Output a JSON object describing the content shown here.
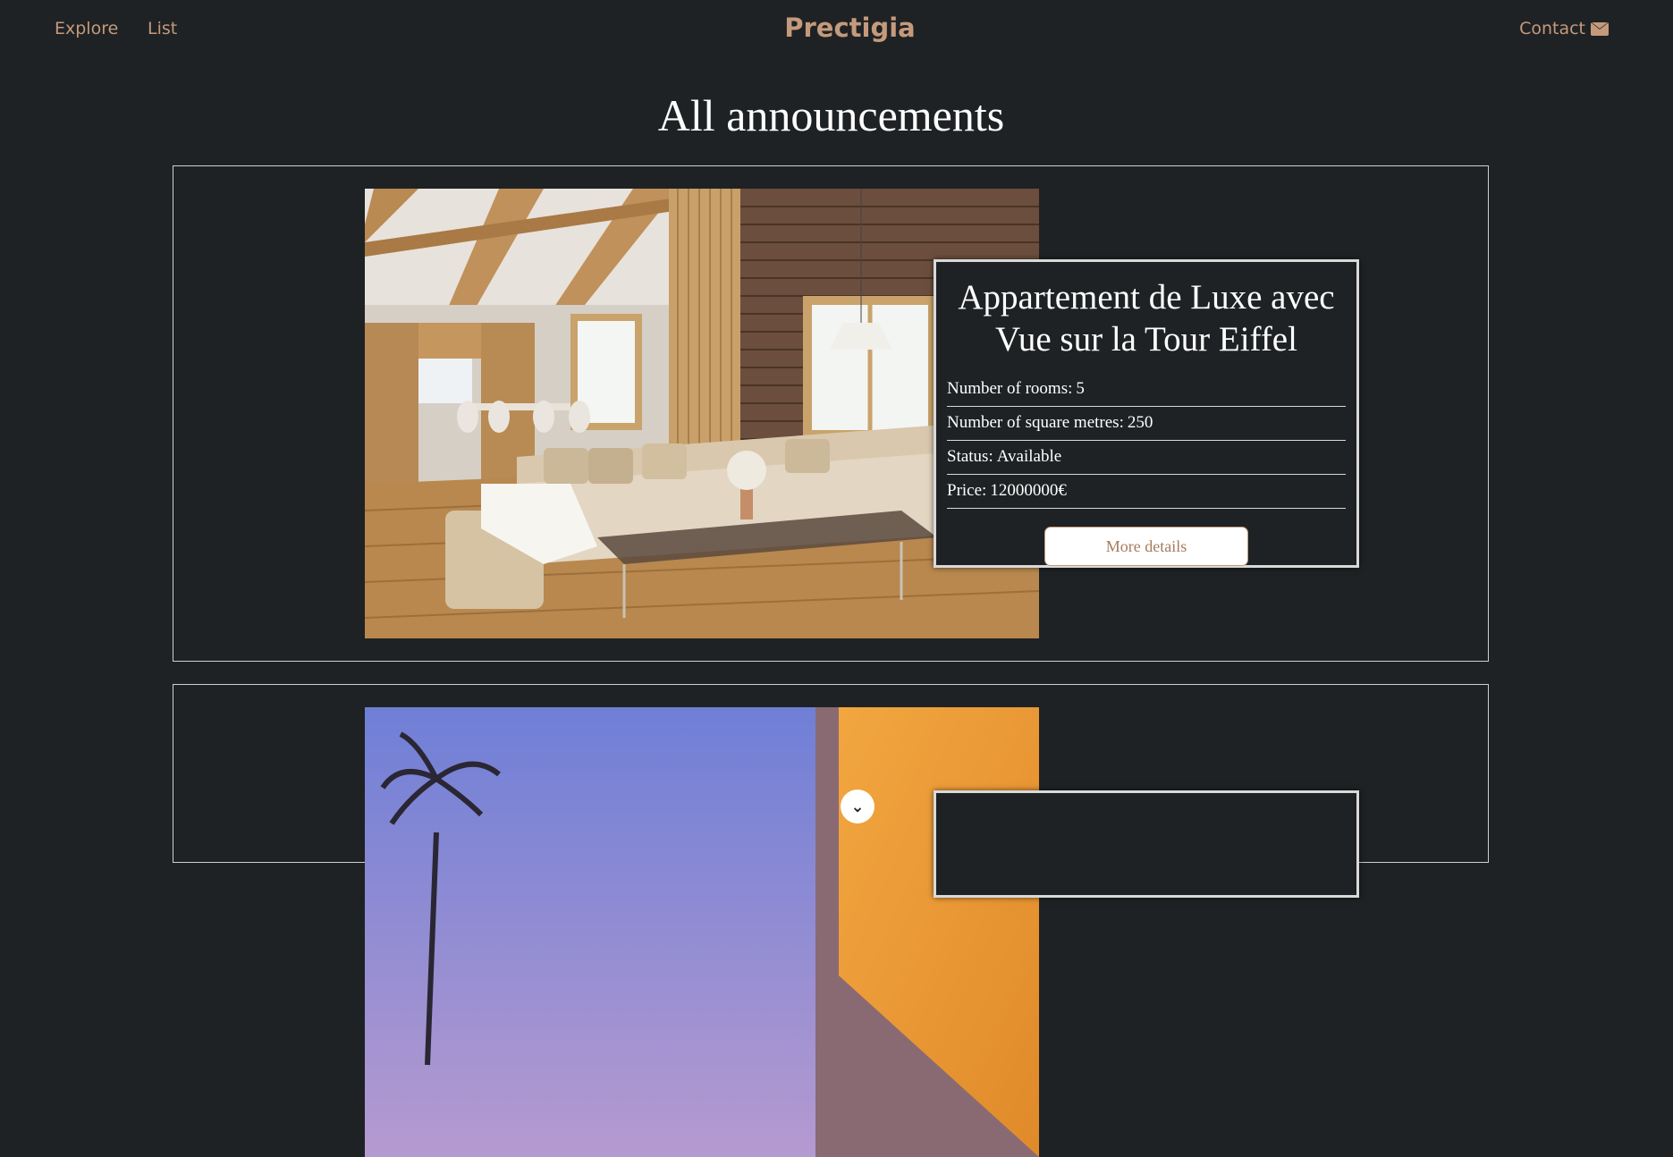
{
  "navbar": {
    "explore_label": "Explore",
    "list_label": "List",
    "brand": "Prectigia",
    "contact_label": "Contact",
    "contact_icon": "envelope-icon"
  },
  "page": {
    "title": "All announcements"
  },
  "colors": {
    "background": "#1f2224",
    "accent": "#c49a7c",
    "text": "#ffffff",
    "border": "#d9d9d9"
  },
  "announcements": [
    {
      "title": "Appartement de Luxe avec Vue sur la Tour Eiffel",
      "image": "modern-living-room-with-beams-and-brick-wall",
      "rooms_label": "Number of rooms:",
      "rooms": "5",
      "area_label": "Number of square metres:",
      "area": "250",
      "status_label": "Status:",
      "status": "Available",
      "price_label": "Price:",
      "price": "12000000€",
      "button_label": "More details"
    },
    {
      "image": "villa-pool-with-palm-trees-at-dusk",
      "overlay_icon": "chevron-down-icon"
    }
  ]
}
